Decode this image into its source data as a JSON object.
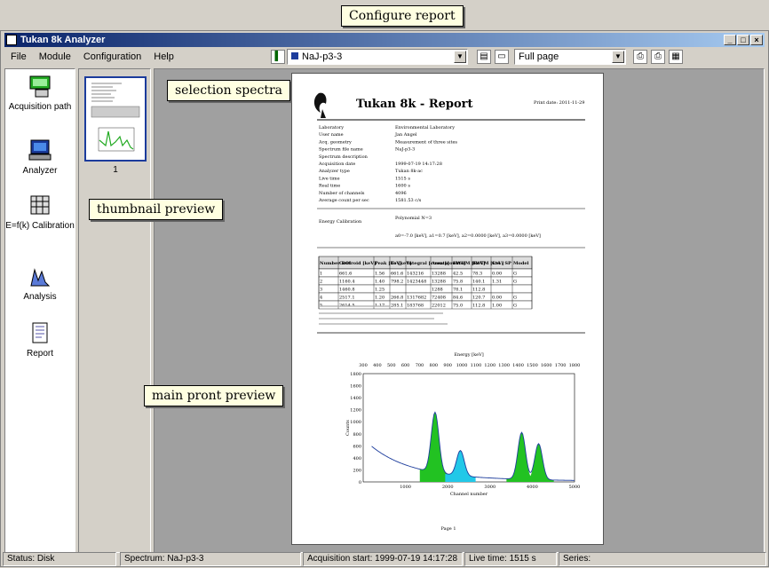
{
  "window": {
    "title": "Tukan 8k Analyzer"
  },
  "menu": [
    "File",
    "Module",
    "Configuration",
    "Help"
  ],
  "toolbar": {
    "spectrum_select": "NaJ-p3-3",
    "zoom_select": "Full page"
  },
  "left_panel": {
    "items": [
      "Acquisition path",
      "Analyzer",
      "E=f(k) Calibration",
      "Analysis",
      "Report"
    ]
  },
  "thumbnail": {
    "number": "1"
  },
  "report": {
    "title": "Tukan 8k - Report",
    "date_label": "Print date: 2011-11-29",
    "fields": [
      [
        "Laboratory",
        "Environmental Laboratory"
      ],
      [
        "User name",
        "Jan Angel"
      ],
      [
        "Acq. geometry",
        "Measurement of three sites"
      ],
      [
        "Spectrum file name",
        "NaJ-p3-3"
      ],
      [
        "Spectrum description",
        ""
      ],
      [
        "Acquisition date",
        "1999-07-19 14:17:28"
      ],
      [
        "Analyzer type",
        "Tukan 8k-ac"
      ],
      [
        "Live time",
        "1515 s"
      ],
      [
        "Real time",
        "1600 s"
      ],
      [
        "Number of channels",
        "4096"
      ],
      [
        "Average count per sec",
        "1581.53 c/s"
      ]
    ],
    "calibration_label": "Energy Calibration",
    "calibration_type": "Polynomial N=3",
    "calibration_formula": "a0=-7.0 [keV], a1=0.7 [keV], a2=0.0000 [keV], a3=0.0000 [keV]",
    "table_headers": [
      "Number ROI",
      "Centroid [keV]",
      "Peak [keV]",
      "To [keV]",
      "Integral [counts]",
      "Area [counts]",
      "FWHM [keV]",
      "FWTM [keV]",
      "Cts / SP",
      "Model"
    ],
    "table_rows": [
      [
        "1",
        "661.6",
        "1.56",
        "661.6",
        "143216",
        "13288",
        "42.5",
        "78.3",
        "0.00",
        "G"
      ],
      [
        "2",
        "1160.4",
        "1.40",
        "798.2",
        "1423448",
        "13288",
        "75.8",
        "140.1",
        "1.31",
        "G"
      ],
      [
        "3",
        "1460.8",
        "1.25",
        "",
        "",
        "1288",
        "78.1",
        "112.8",
        "",
        ""
      ],
      [
        "4",
        "2517.1",
        "1.20",
        "266.8",
        "1317682",
        "72408",
        "84.6",
        "120.7",
        "0.00",
        "G"
      ],
      [
        "5",
        "2614.5",
        "1.17",
        "285.1",
        "183768",
        "22012",
        "75.0",
        "112.8",
        "1.00",
        "G"
      ]
    ],
    "chart_title": "Energy [keV]",
    "chart_xlabel": "Channel number",
    "chart_ylabel": "Counts",
    "footer": "Page 1"
  },
  "chart_data": {
    "type": "area",
    "title": "",
    "xlabel": "Channel number",
    "ylabel": "Counts",
    "x_ticks": [
      "1000",
      "2000",
      "3000",
      "4000",
      "5000"
    ],
    "y_ticks": [
      "0",
      "200",
      "400",
      "600",
      "800",
      "1000",
      "1200",
      "1400",
      "1600",
      "1800"
    ],
    "top_axis_label": "Energy [keV]",
    "top_ticks": [
      "300",
      "400",
      "500",
      "600",
      "700",
      "800",
      "900",
      "1000",
      "1100",
      "1200",
      "1300",
      "1400",
      "1500",
      "1600",
      "1700",
      "1800"
    ],
    "ylim": [
      0,
      1800
    ],
    "xlim": [
      0,
      5000
    ],
    "peaks": [
      {
        "center": 1700,
        "height": 1000,
        "color": "#22c222"
      },
      {
        "center": 2300,
        "height": 420,
        "color": "#22c8e8"
      },
      {
        "center": 3750,
        "height": 780,
        "color": "#22c222"
      },
      {
        "center": 4150,
        "height": 600,
        "color": "#22c222"
      }
    ]
  },
  "callouts": {
    "configure": "Configure report",
    "selection": "selection spectra",
    "thumbnail": "thumbnail preview",
    "main": "main pront preview"
  },
  "status": {
    "disk": "Status: Disk",
    "spectrum": "Spectrum: NaJ-p3-3",
    "acq": "Acquisition start: 1999-07-19 14:17:28",
    "live": "Live time: 1515 s",
    "series": "Series:"
  }
}
